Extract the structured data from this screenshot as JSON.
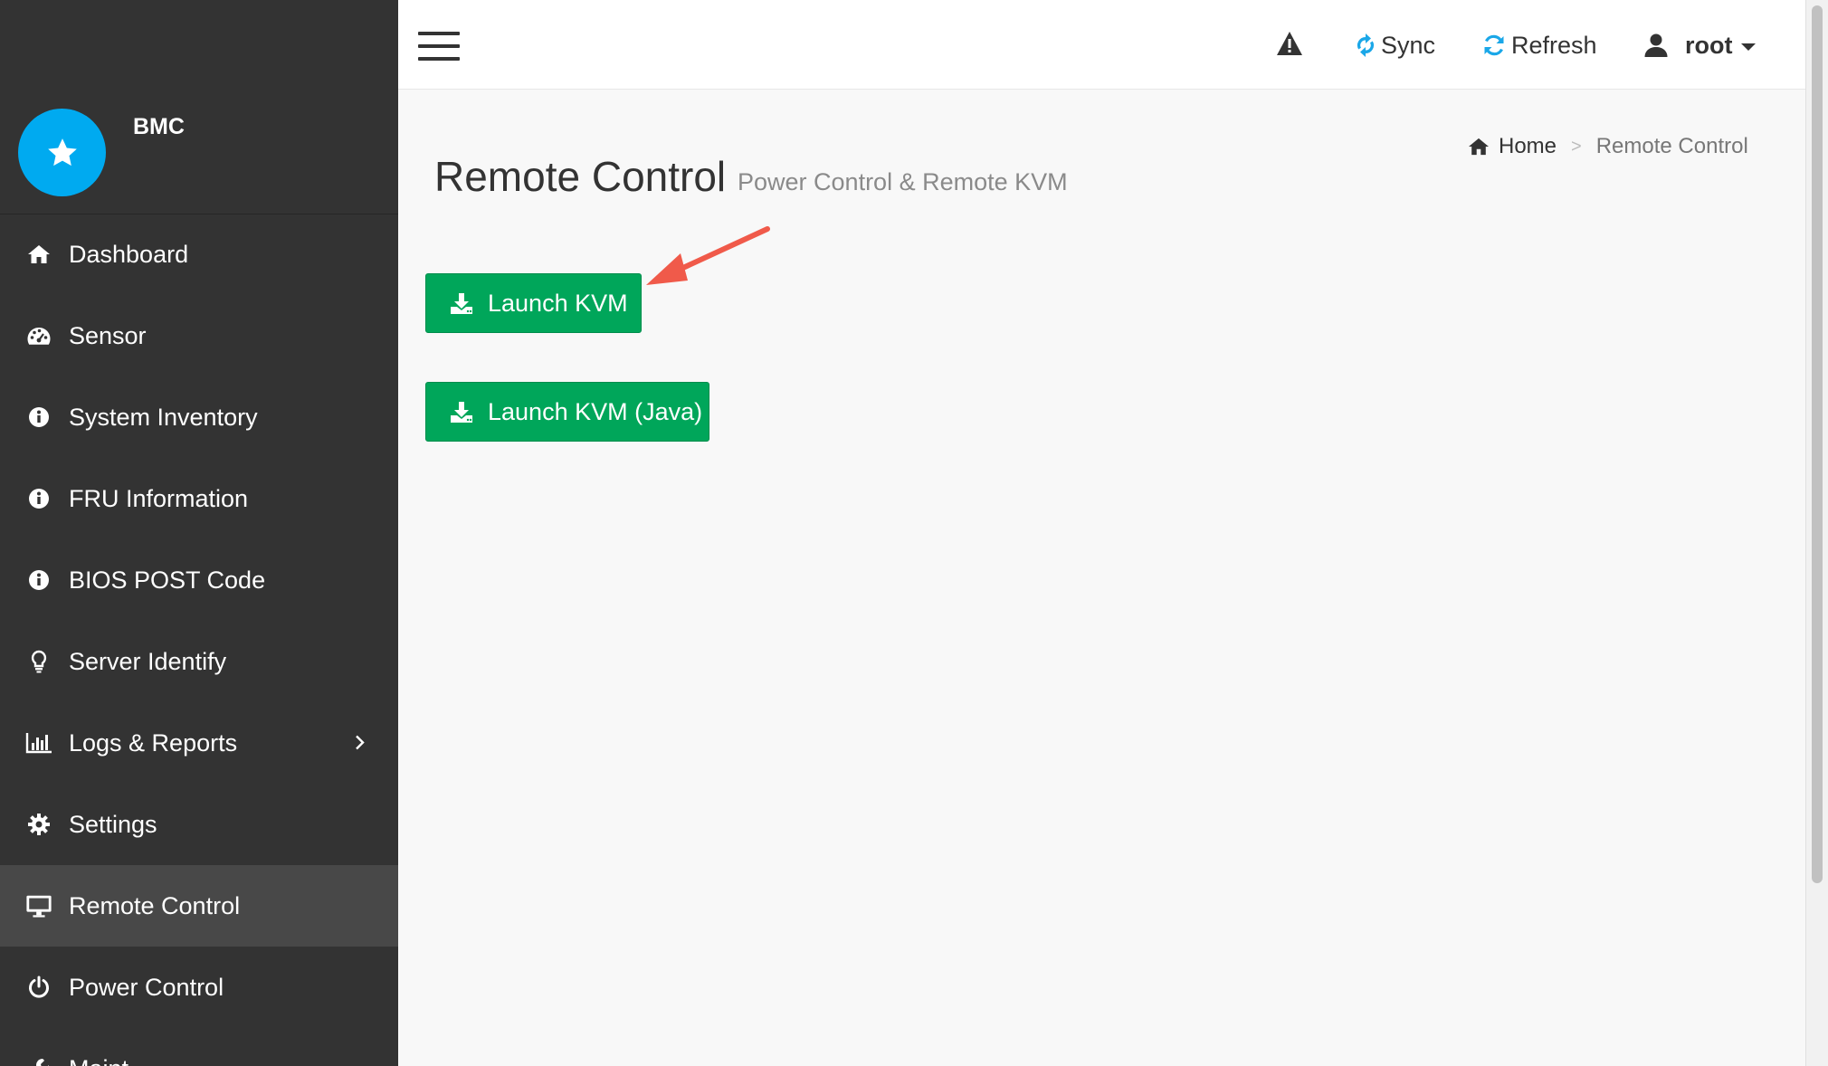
{
  "brand": {
    "name": "BMC"
  },
  "sidebar": {
    "items": [
      {
        "label": "Dashboard",
        "icon": "home-icon"
      },
      {
        "label": "Sensor",
        "icon": "dashboard-gauge-icon"
      },
      {
        "label": "System Inventory",
        "icon": "info-icon"
      },
      {
        "label": "FRU Information",
        "icon": "info-icon"
      },
      {
        "label": "BIOS POST Code",
        "icon": "info-icon"
      },
      {
        "label": "Server Identify",
        "icon": "lightbulb-icon"
      },
      {
        "label": "Logs & Reports",
        "icon": "bar-chart-icon"
      },
      {
        "label": "Settings",
        "icon": "gear-icon"
      },
      {
        "label": "Remote Control",
        "icon": "monitor-icon",
        "active": true
      },
      {
        "label": "Power Control",
        "icon": "power-icon"
      },
      {
        "label": "Maint",
        "icon": "wrench-icon"
      }
    ]
  },
  "topbar": {
    "sync_label": "Sync",
    "refresh_label": "Refresh",
    "user_label": "root"
  },
  "page": {
    "title": "Remote Control",
    "subtitle": "Power Control & Remote KVM"
  },
  "breadcrumb": {
    "home": "Home",
    "separator": ">",
    "current": "Remote Control"
  },
  "buttons": {
    "launch_kvm": "Launch KVM",
    "launch_kvm_java": "Launch KVM (Java)"
  },
  "colors": {
    "sidebar_bg": "#333333",
    "accent_blue": "#00aaf0",
    "button_green": "#00a65a",
    "annotation_red": "#f05a4a"
  }
}
